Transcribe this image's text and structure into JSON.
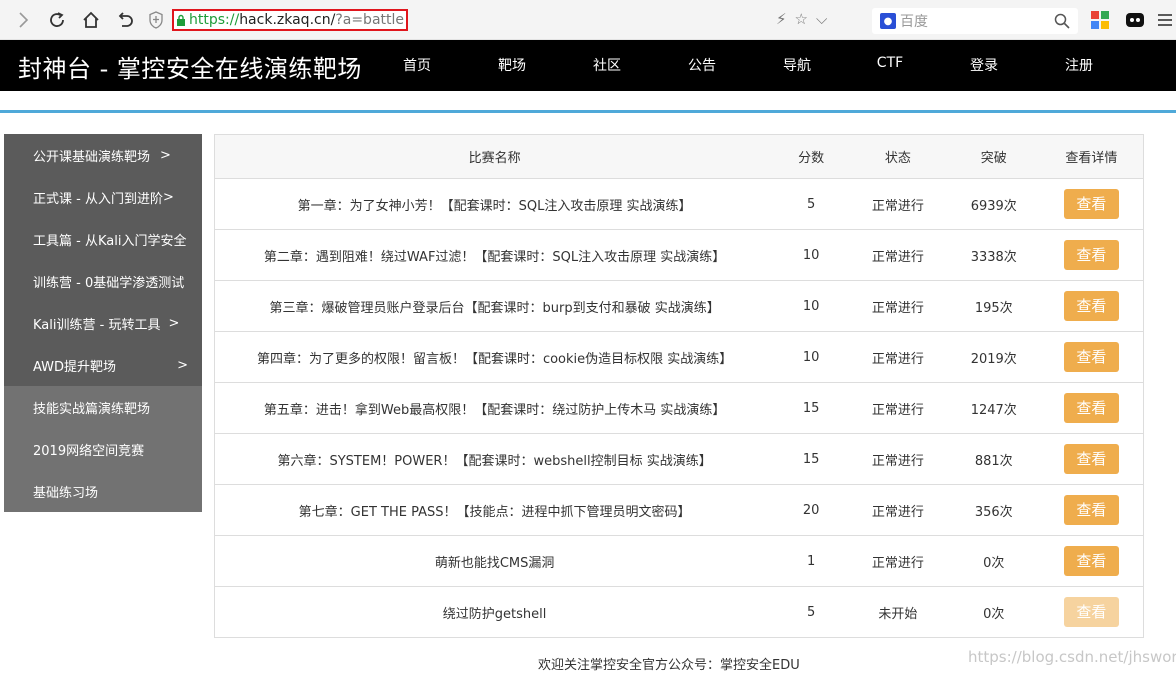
{
  "browser": {
    "url_scheme": "https://",
    "url_host": "hack.zkaq.cn/",
    "url_path": "?a=battle",
    "search_placeholder": "百度"
  },
  "site": {
    "title": "封神台 - 掌控安全在线演练靶场",
    "nav": [
      "首页",
      "靶场",
      "社区",
      "公告",
      "导航",
      "CTF",
      "登录",
      "注册"
    ]
  },
  "sidebar": {
    "items": [
      {
        "label": "公开课基础演练靶场",
        "chevron": ">"
      },
      {
        "label": "正式课 - 从入门到进阶",
        "chevron": ">"
      },
      {
        "label": "工具篇 - 从Kali入门学安全",
        "chevron": ""
      },
      {
        "label": "训练营 - 0基础学渗透测试",
        "chevron": ""
      },
      {
        "label": "Kali训练营 - 玩转工具",
        "chevron": ">"
      },
      {
        "label": "AWD提升靶场",
        "chevron": ">"
      },
      {
        "label": "技能实战篇演练靶场",
        "chevron": ""
      },
      {
        "label": "2019网络空间竞赛",
        "chevron": ""
      },
      {
        "label": "基础练习场",
        "chevron": ""
      }
    ]
  },
  "table": {
    "headers": [
      "比赛名称",
      "分数",
      "状态",
      "突破",
      "查看详情"
    ],
    "rows": [
      {
        "name": "第一章：为了女神小芳！【配套课时：SQL注入攻击原理 实战演练】",
        "score": "5",
        "status": "正常进行",
        "breakthrough": "6939次",
        "button": "查看",
        "active": true
      },
      {
        "name": "第二章：遇到阻难！绕过WAF过滤！【配套课时：SQL注入攻击原理 实战演练】",
        "score": "10",
        "status": "正常进行",
        "breakthrough": "3338次",
        "button": "查看",
        "active": true
      },
      {
        "name": "第三章：爆破管理员账户登录后台【配套课时：burp到支付和暴破 实战演练】",
        "score": "10",
        "status": "正常进行",
        "breakthrough": "195次",
        "button": "查看",
        "active": true
      },
      {
        "name": "第四章：为了更多的权限！留言板！【配套课时：cookie伪造目标权限 实战演练】",
        "score": "10",
        "status": "正常进行",
        "breakthrough": "2019次",
        "button": "查看",
        "active": true
      },
      {
        "name": "第五章：进击！拿到Web最高权限！【配套课时：绕过防护上传木马 实战演练】",
        "score": "15",
        "status": "正常进行",
        "breakthrough": "1247次",
        "button": "查看",
        "active": true
      },
      {
        "name": "第六章：SYSTEM！POWER！【配套课时：webshell控制目标 实战演练】",
        "score": "15",
        "status": "正常进行",
        "breakthrough": "881次",
        "button": "查看",
        "active": true
      },
      {
        "name": "第七章：GET THE PASS！【技能点：进程中抓下管理员明文密码】",
        "score": "20",
        "status": "正常进行",
        "breakthrough": "356次",
        "button": "查看",
        "active": true
      },
      {
        "name": "萌新也能找CMS漏洞",
        "score": "1",
        "status": "正常进行",
        "breakthrough": "0次",
        "button": "查看",
        "active": true
      },
      {
        "name": "绕过防护getshell",
        "score": "5",
        "status": "未开始",
        "breakthrough": "0次",
        "button": "查看",
        "active": false
      }
    ]
  },
  "footer": "欢迎关注掌控安全官方公众号：掌控安全EDU",
  "watermark": "https://blog.csdn.net/jhsword",
  "colors": {
    "header_bg": "#000000",
    "accent_line": "#4fa9d9",
    "button": "#efad4d",
    "status_running": "#3d8b3d",
    "status_pending": "#a83232",
    "url_highlight": "#e0161d"
  }
}
